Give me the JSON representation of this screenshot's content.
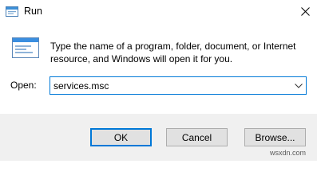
{
  "window": {
    "title": "Run",
    "app_icon": "run-app-icon",
    "close_icon": "close-icon"
  },
  "description": "Type the name of a program, folder, document, or Internet resource, and Windows will open it for you.",
  "open": {
    "label": "Open:",
    "value": "services.msc"
  },
  "buttons": {
    "ok": "OK",
    "cancel": "Cancel",
    "browse": "Browse..."
  },
  "watermark": "wsxdn.com",
  "colors": {
    "accent": "#0078d7",
    "footer_bg": "#f0f0f0",
    "button_bg": "#e1e1e1"
  }
}
